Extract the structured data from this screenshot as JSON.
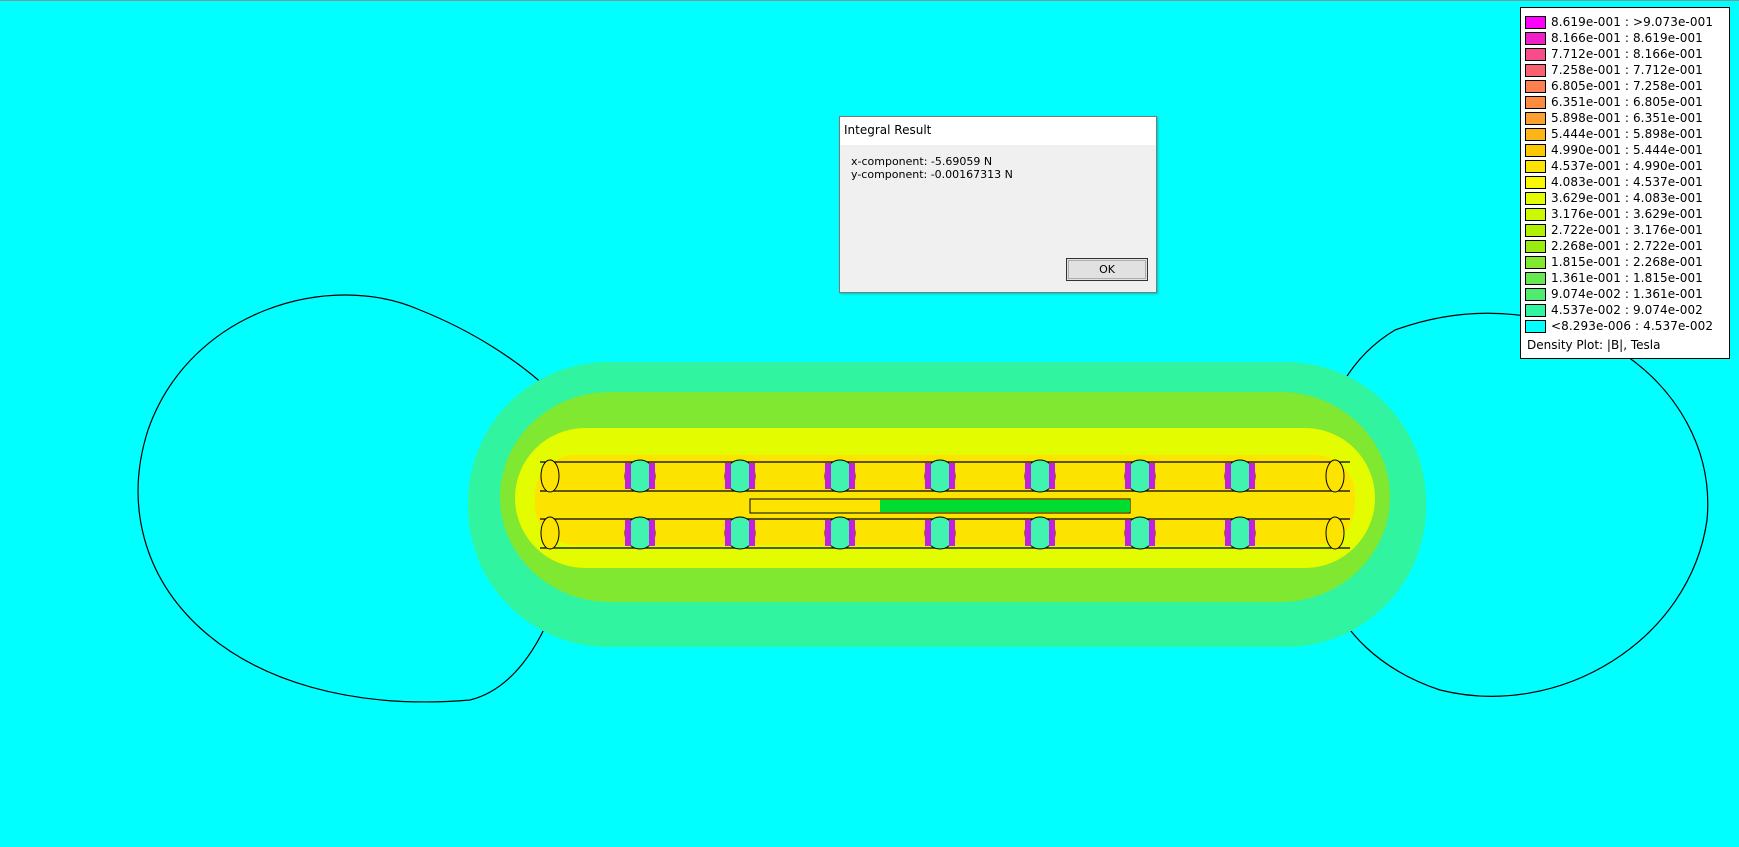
{
  "legend": {
    "items": [
      {
        "label": "8.619e-001 : >9.073e-001",
        "color": "#ff00ff"
      },
      {
        "label": "8.166e-001 : 8.619e-001",
        "color": "#f020c8"
      },
      {
        "label": "7.712e-001 : 8.166e-001",
        "color": "#f84c8c"
      },
      {
        "label": "7.258e-001 : 7.712e-001",
        "color": "#fb6070"
      },
      {
        "label": "6.805e-001 : 7.258e-001",
        "color": "#fc8050"
      },
      {
        "label": "6.351e-001 : 6.805e-001",
        "color": "#fc8c40"
      },
      {
        "label": "5.898e-001 : 6.351e-001",
        "color": "#fca030"
      },
      {
        "label": "5.444e-001 : 5.898e-001",
        "color": "#fcb418"
      },
      {
        "label": "4.990e-001 : 5.444e-001",
        "color": "#fcc800"
      },
      {
        "label": "4.537e-001 : 4.990e-001",
        "color": "#fce400"
      },
      {
        "label": "4.083e-001 : 4.537e-001",
        "color": "#f8f800"
      },
      {
        "label": "3.629e-001 : 4.083e-001",
        "color": "#e4fc00"
      },
      {
        "label": "3.176e-001 : 3.629e-001",
        "color": "#ccf800"
      },
      {
        "label": "2.722e-001 : 3.176e-001",
        "color": "#b0f000"
      },
      {
        "label": "2.268e-001 : 2.722e-001",
        "color": "#98ec10"
      },
      {
        "label": "1.815e-001 : 2.268e-001",
        "color": "#80e830"
      },
      {
        "label": "1.361e-001 : 1.815e-001",
        "color": "#68e850"
      },
      {
        "label": "9.074e-002 : 1.361e-001",
        "color": "#50ec70"
      },
      {
        "label": "4.537e-002 : 9.074e-002",
        "color": "#30f4a0"
      },
      {
        "label": "<8.293e-006 : 4.537e-002",
        "color": "#00ffff"
      }
    ],
    "caption": "Density Plot: |B|, Tesla"
  },
  "dialog": {
    "title": "Integral Result",
    "lines": [
      "x-component: -5.69059 N",
      "y-component: -0.00167313 N"
    ],
    "ok_label": "OK"
  }
}
